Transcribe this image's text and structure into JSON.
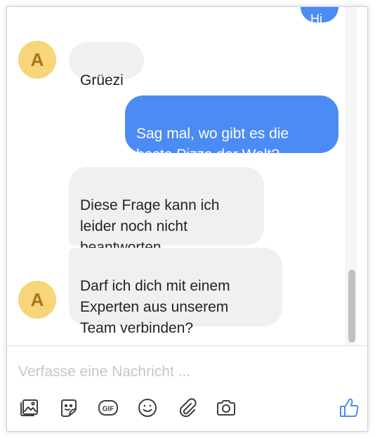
{
  "avatar_letter": "A",
  "messages": [
    {
      "id": "partial",
      "text": "Hi"
    },
    {
      "id": "m1",
      "text": "Grüezi"
    },
    {
      "id": "m2",
      "text": "Sag mal, wo gibt es die\nbeste Pizza der Welt?"
    },
    {
      "id": "m3",
      "text": "Diese Frage kann ich\nleider noch nicht\nbeantworten."
    },
    {
      "id": "m4",
      "text": "Darf ich dich mit einem\nExperten aus unserem\nTeam verbinden?"
    }
  ],
  "composer": {
    "placeholder": "Verfasse eine Nachricht ...",
    "tools": [
      "image-icon",
      "sticker-icon",
      "gif-icon",
      "emoji-icon",
      "attachment-icon",
      "camera-icon"
    ],
    "like": "thumbs-up-icon"
  },
  "colors": {
    "accent": "#4b8bf4",
    "incoming": "#f0f0f1",
    "avatar": "#f8d47a",
    "avatar_text": "#a8741c"
  }
}
